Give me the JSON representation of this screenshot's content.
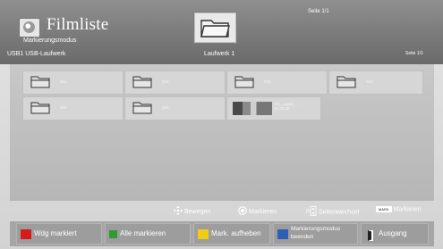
{
  "header": {
    "title": "Filmliste",
    "mode": "Markierungsmodus",
    "usb": "USB1   USB-Laufwerk",
    "page_top": "Seite 1/1",
    "drive_label": "Laufwerk 1",
    "page_right": "Seite 1/1"
  },
  "grid": {
    "folders": [
      "001",
      "002",
      "003",
      "004",
      "005",
      "006"
    ],
    "photo_name_line1": "001_Apple_ . . .",
    "photo_name_line2": "00:36:28"
  },
  "hints": {
    "move": "Bewegen",
    "mark": "Markieren",
    "page_switch": "Seitenwechsel",
    "mark_chip": "MARK",
    "mark2": "Markieren"
  },
  "buttons": {
    "play_marked": "Wdg markiert",
    "mark_all": "Alle markieren",
    "unmark": "Mark. aufheben",
    "exit_mark_mode_line1": "Markierungsmodus",
    "exit_mark_mode_line2": "beenden",
    "exit": "Ausgang"
  },
  "colors": {
    "header": "#7d7d7d",
    "content": "#bcbcbc",
    "tile": "#d6d6d6",
    "red": "#d61b1b",
    "green": "#2f9a2f",
    "yellow": "#f1cc12",
    "blue": "#2f5eb7"
  },
  "icons": {
    "app": "media-icon",
    "drive": "folder-icon",
    "move": "move-arrows-icon",
    "ok": "ok-button-icon",
    "page": "page-up-down-icon",
    "exit": "exit-door-icon"
  }
}
